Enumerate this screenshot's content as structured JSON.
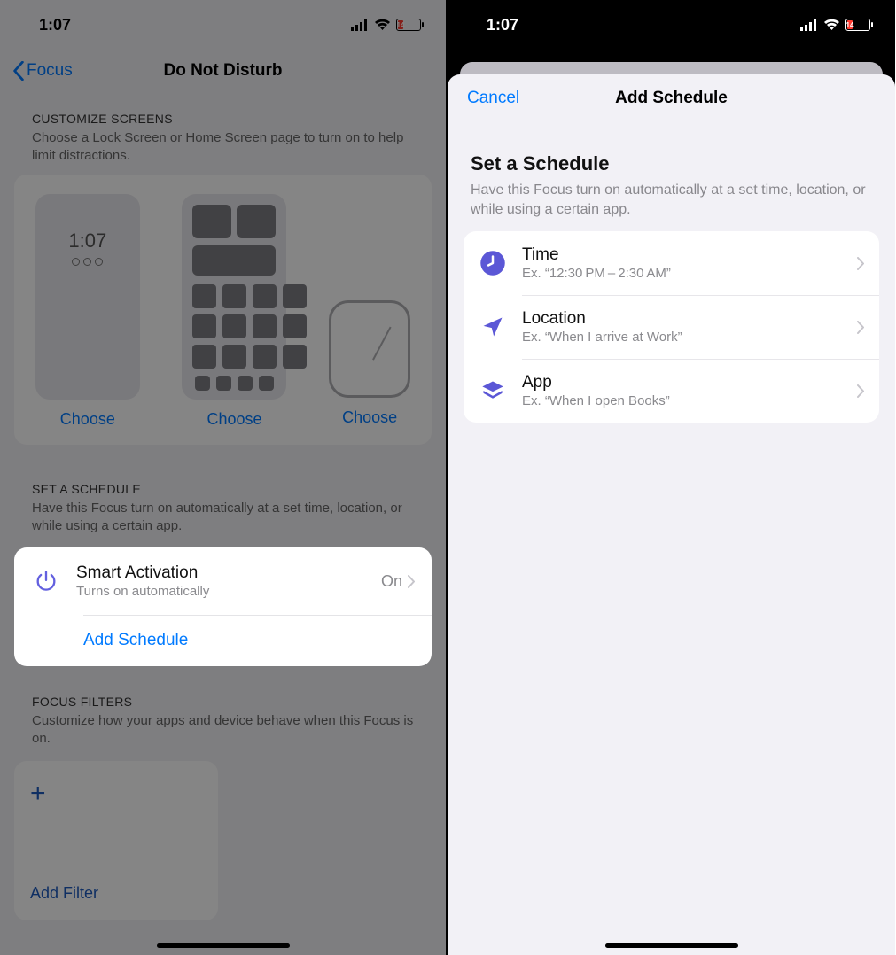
{
  "status": {
    "time": "1:07",
    "battery_text": "14"
  },
  "left": {
    "back_label": "Focus",
    "title": "Do Not Disturb",
    "customize": {
      "header": "CUSTOMIZE SCREENS",
      "sub": "Choose a Lock Screen or Home Screen page to turn on to help limit distractions.",
      "lock_time": "1:07",
      "choose_label": "Choose"
    },
    "schedule": {
      "header": "SET A SCHEDULE",
      "sub": "Have this Focus turn on automatically at a set time, location, or while using a certain app.",
      "smart_title": "Smart Activation",
      "smart_sub": "Turns on automatically",
      "smart_value": "On",
      "add_label": "Add Schedule"
    },
    "filters": {
      "header": "FOCUS FILTERS",
      "sub": "Customize how your apps and device behave when this Focus is on.",
      "add_label": "Add Filter"
    }
  },
  "right": {
    "cancel": "Cancel",
    "title": "Add Schedule",
    "section_title": "Set a Schedule",
    "section_sub": "Have this Focus turn on automatically at a set time, location, or while using a certain app.",
    "options": [
      {
        "title": "Time",
        "sub": "Ex. “12:30 PM – 2:30 AM”"
      },
      {
        "title": "Location",
        "sub": "Ex. “When I arrive at Work”"
      },
      {
        "title": "App",
        "sub": "Ex. “When I open Books”"
      }
    ]
  }
}
